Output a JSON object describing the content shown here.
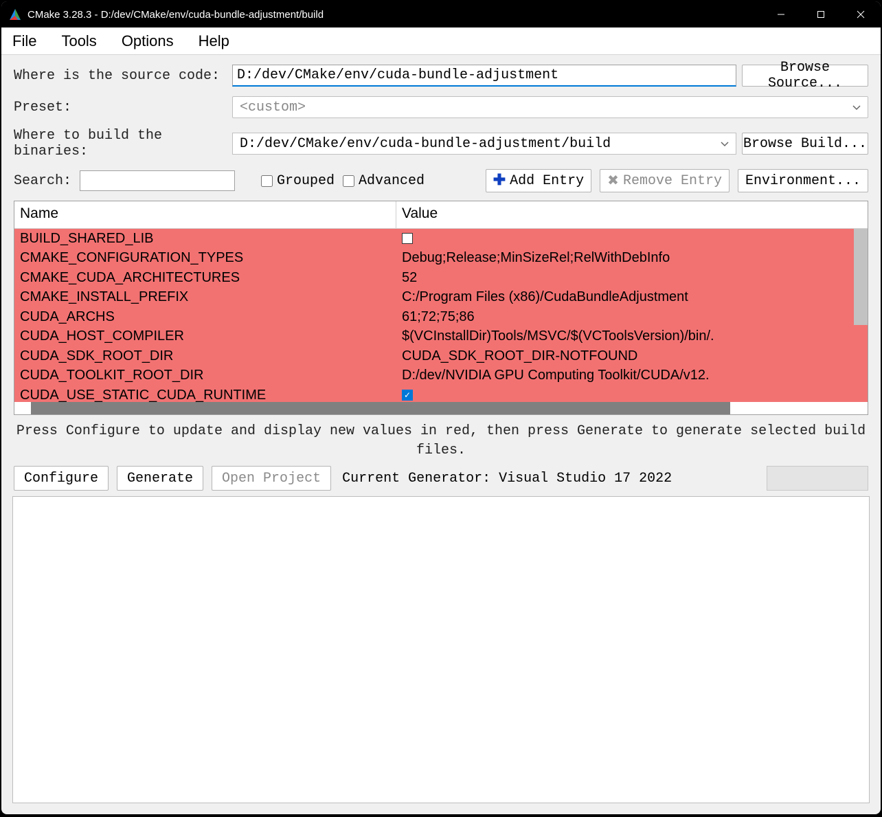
{
  "window": {
    "title": "CMake 3.28.3 - D:/dev/CMake/env/cuda-bundle-adjustment/build"
  },
  "menubar": {
    "file": "File",
    "tools": "Tools",
    "options": "Options",
    "help": "Help"
  },
  "labels": {
    "source": "Where is the source code:",
    "preset": "Preset:",
    "build": "Where to build the binaries:",
    "search": "Search:"
  },
  "paths": {
    "source": "D:/dev/CMake/env/cuda-bundle-adjustment",
    "preset": "<custom>",
    "build": "D:/dev/CMake/env/cuda-bundle-adjustment/build"
  },
  "buttons": {
    "browse_source": "Browse Source...",
    "browse_build": "Browse Build...",
    "grouped": "Grouped",
    "advanced": "Advanced",
    "add_entry": "Add Entry",
    "remove_entry": "Remove Entry",
    "environment": "Environment...",
    "configure": "Configure",
    "generate": "Generate",
    "open_project": "Open Project"
  },
  "table": {
    "header_name": "Name",
    "header_value": "Value",
    "rows": [
      {
        "name": "BUILD_SHARED_LIB",
        "value": "",
        "type": "checkbox_unchecked"
      },
      {
        "name": "CMAKE_CONFIGURATION_TYPES",
        "value": "Debug;Release;MinSizeRel;RelWithDebInfo",
        "type": "text"
      },
      {
        "name": "CMAKE_CUDA_ARCHITECTURES",
        "value": "52",
        "type": "text"
      },
      {
        "name": "CMAKE_INSTALL_PREFIX",
        "value": "C:/Program Files (x86)/CudaBundleAdjustment",
        "type": "text"
      },
      {
        "name": "CUDA_ARCHS",
        "value": "61;72;75;86",
        "type": "text"
      },
      {
        "name": "CUDA_HOST_COMPILER",
        "value": "$(VCInstallDir)Tools/MSVC/$(VCToolsVersion)/bin/.",
        "type": "text"
      },
      {
        "name": "CUDA_SDK_ROOT_DIR",
        "value": "CUDA_SDK_ROOT_DIR-NOTFOUND",
        "type": "text"
      },
      {
        "name": "CUDA_TOOLKIT_ROOT_DIR",
        "value": "D:/dev/NVIDIA GPU Computing Toolkit/CUDA/v12.",
        "type": "text"
      },
      {
        "name": "CUDA_USE_STATIC_CUDA_RUNTIME",
        "value": "",
        "type": "checkbox_checked"
      }
    ]
  },
  "hint": "Press Configure to update and display new values in red, then press Generate to generate selected build files.",
  "generator": "Current Generator: Visual Studio 17 2022"
}
